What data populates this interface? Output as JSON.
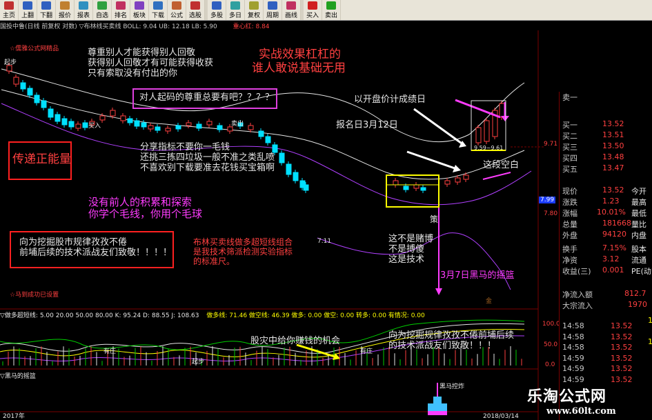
{
  "toolbar": [
    {
      "label": "主页",
      "color": "#c03030"
    },
    {
      "label": "上翻",
      "color": "#3060c0"
    },
    {
      "label": "下翻",
      "color": "#3060c0"
    },
    {
      "label": "报价",
      "color": "#c08030"
    },
    {
      "label": "报表",
      "color": "#3090c0"
    },
    {
      "label": "自选",
      "color": "#30a040"
    },
    {
      "label": "排名",
      "color": "#c03060"
    },
    {
      "label": "板块",
      "color": "#8040c0"
    },
    {
      "label": "下载",
      "color": "#3070c0"
    },
    {
      "label": "公式",
      "color": "#c06030"
    },
    {
      "label": "选股",
      "color": "#c03030"
    },
    {
      "label": "多股",
      "color": "#3060c0"
    },
    {
      "label": "多日",
      "color": "#30a0a0"
    },
    {
      "label": "复权",
      "color": "#a0a030"
    },
    {
      "label": "周期",
      "color": "#3060c0"
    },
    {
      "label": "画线",
      "color": "#c03060"
    },
    {
      "label": "买入",
      "color": "#d02020"
    },
    {
      "label": "卖出",
      "color": "#20a020"
    }
  ],
  "chart_header": {
    "title": "国投中鲁(日线 前复权 对数) ▽布林线买卖线 BOLL: 9.04  UB: 12.18  LB: 5.90",
    "highlight": "重心红: 8.84"
  },
  "chart_labels": {
    "indicator_line1": "☆儒雅公式网精品",
    "indicator_line2": "☆马到成功已设置",
    "small_buy": "买入",
    "small_sell": "卖出",
    "tag_start": "起步",
    "range_label": "9.59~9.61",
    "low_label": "7.11",
    "ticks_right": [
      "9.71",
      "7.99",
      "7.80"
    ],
    "gem_icon": "金"
  },
  "annotations": {
    "respect": [
      "尊重别人才能获得别人回敬",
      "获得别人回敬才有可能获得收获",
      "只有索取没有付出的你"
    ],
    "effect": [
      "实战效果杠杠的",
      "谁人敢说基础无用"
    ],
    "respect_box": "对人起码的尊重总要有吧？？？？",
    "positive_energy": "传递正能量",
    "share": [
      "分享指标不要你一毛钱",
      "还挑三拣四垃圾一般不准之类乱喷",
      "不喜欢别下载要准去花钱买宝箱啊"
    ],
    "open_price": "以开盘价计成绩日",
    "signup": "报名日3月12日",
    "gap": "这段空白",
    "no_accum": [
      "没有前人的积累和探索",
      "你学个毛线，你用个毛球"
    ],
    "salute_box": [
      "向为挖掘股市规律孜孜不倦",
      "前埔后续的技术派战友们致敬！！！！"
    ],
    "boll_note": [
      "布林买卖线做多超短线组合",
      "是我技术筛派检测实验指标",
      "的标准尺。"
    ],
    "not_gamble": [
      "这不是赌博",
      "不是搏傻",
      "这是技术"
    ],
    "black_horse": "3月7日黑马的摇篮",
    "disaster": "股灾中给你赚钱的机会",
    "salute2": [
      "向为挖掘规律孜孜不倦前埔后续",
      "的技术派战友们致敬！！！"
    ],
    "char_ce": "策",
    "sub_labels": {
      "a": "有庄",
      "b": "有庄",
      "c": "起步"
    }
  },
  "sub_indicator": {
    "header_a": "▽做多超短线: 5.00   20.00   50.00   80.00   K: 95.24  D: 88.55  J: 108.63",
    "header_b": "做多线: 71.46   做空线: 46.39   做多: 0.00   做空: 0.00   转多: 0.00   有情况: 0.00",
    "header_c": "▽黑马的摇篮",
    "hm_label": "黑马控炸",
    "scale": [
      "100.0",
      "50.0",
      "0.0"
    ]
  },
  "quote_panel": {
    "sell_rows": [
      {
        "label": "卖一"
      }
    ],
    "buy_rows": [
      {
        "label": "买一",
        "price": "13.52"
      },
      {
        "label": "买二",
        "price": "13.51"
      },
      {
        "label": "买三",
        "price": "13.50"
      },
      {
        "label": "买四",
        "price": "13.48"
      },
      {
        "label": "买五",
        "price": "13.47"
      }
    ],
    "stats": [
      {
        "k": "现价",
        "v": "13.52",
        "k2": "今开"
      },
      {
        "k": "涨跌",
        "v": "1.23",
        "k2": "最高"
      },
      {
        "k": "涨幅",
        "v": "10.01%",
        "k2": "最低"
      },
      {
        "k": "总量",
        "v": "181668",
        "k2": "量比"
      },
      {
        "k": "外盘",
        "v": "94120",
        "k2": "内盘"
      },
      {
        "k": "换手",
        "v": "7.15%",
        "k2": "股本"
      },
      {
        "k": "净资",
        "v": "3.12",
        "k2": "流通"
      },
      {
        "k": "收益(三)",
        "v": "0.001",
        "k2": "PE(动)"
      }
    ],
    "net_inflow": {
      "k": "净流入额",
      "v": "812.7"
    },
    "block_inflow": {
      "k": "大宗流入",
      "v": "1970"
    },
    "ticks": [
      {
        "t": "14:58",
        "p": "13.52"
      },
      {
        "t": "14:58",
        "p": "13.52"
      },
      {
        "t": "14:58",
        "p": "13.52"
      },
      {
        "t": "14:59",
        "p": "13.52"
      },
      {
        "t": "14:59",
        "p": "13.52"
      },
      {
        "t": "14:59",
        "p": "13.52"
      }
    ],
    "side_digits": [
      "1",
      "1"
    ]
  },
  "bottom_dates": [
    "2017年",
    "2018/03/14"
  ],
  "watermark": {
    "name": "乐淘公式网",
    "url": "www.60lt.com"
  },
  "colors": {
    "up": "#ff4040",
    "down": "#00e0ff",
    "mid": "#e6e6e6",
    "lower": "#b040ff",
    "accent": "#ff2020"
  }
}
